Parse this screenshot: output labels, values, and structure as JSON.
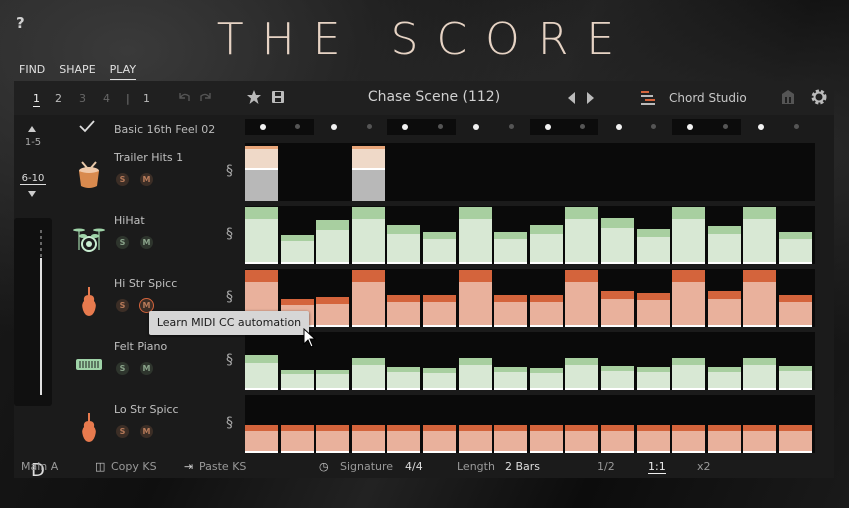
{
  "app": {
    "title": "THE SCORE",
    "help_label": "?"
  },
  "modes": [
    {
      "label": "FIND",
      "active": false
    },
    {
      "label": "SHAPE",
      "active": false
    },
    {
      "label": "PLAY",
      "active": true
    }
  ],
  "toolbar": {
    "pages": [
      "1",
      "2",
      "3",
      "4"
    ],
    "active_page": "1",
    "page_count": "1",
    "preset_name": "Chase Scene (112)",
    "chord_studio_label": "Chord Studio"
  },
  "left": {
    "range_top": "1-5",
    "range_bottom": "6-10",
    "key": "D"
  },
  "pattern": {
    "name": "Basic 16th Feel 02"
  },
  "tracks": [
    {
      "name": "Trailer Hits 1",
      "icon": "drum-icon"
    },
    {
      "name": "HiHat",
      "icon": "drumkit-icon"
    },
    {
      "name": "Hi Str Spicc",
      "icon": "violin-icon"
    },
    {
      "name": "Felt Piano",
      "icon": "piano-icon"
    },
    {
      "name": "Lo Str Spicc",
      "icon": "violin-icon"
    }
  ],
  "solo_label": "S",
  "mute_label": "M",
  "lanes": [
    {
      "color": "grey",
      "steps": [
        0.95,
        0,
        0,
        0.95,
        0,
        0,
        0,
        0,
        0,
        0,
        0,
        0,
        0,
        0,
        0,
        0
      ]
    },
    {
      "color": "green",
      "steps": [
        0.98,
        0.5,
        0.75,
        0.98,
        0.68,
        0.55,
        0.98,
        0.55,
        0.68,
        0.98,
        0.8,
        0.6,
        0.98,
        0.65,
        0.98,
        0.55
      ]
    },
    {
      "color": "orange",
      "steps": [
        0.98,
        0.48,
        0.52,
        0.98,
        0.55,
        0.55,
        0.98,
        0.55,
        0.55,
        0.98,
        0.62,
        0.58,
        0.98,
        0.62,
        0.98,
        0.55
      ]
    },
    {
      "color": "green",
      "steps": [
        0.6,
        0.35,
        0.35,
        0.55,
        0.4,
        0.38,
        0.55,
        0.4,
        0.38,
        0.55,
        0.42,
        0.4,
        0.55,
        0.4,
        0.55,
        0.42
      ]
    },
    {
      "color": "orange",
      "steps": [
        0.48,
        0.48,
        0.48,
        0.48,
        0.48,
        0.48,
        0.48,
        0.48,
        0.48,
        0.48,
        0.48,
        0.48,
        0.48,
        0.48,
        0.48,
        0.48
      ]
    }
  ],
  "accents": [
    1,
    0,
    1,
    0,
    1,
    0,
    1,
    0,
    1,
    0,
    1,
    0,
    1,
    0,
    1,
    0
  ],
  "bottom": {
    "main": "Main A",
    "copy_ks": "Copy KS",
    "paste_ks": "Paste KS",
    "signature_label": "Signature",
    "signature_value": "4/4",
    "length_label": "Length",
    "length_value": "2 Bars",
    "speed_half": "1/2",
    "speed_one": "1:1",
    "speed_double": "x2"
  },
  "tooltip": {
    "text": "Learn MIDI CC automation"
  },
  "colors": {
    "green_top": "#a8cfa0",
    "green_body": "#d8e8d4",
    "orange_top": "#d4643c",
    "orange_body": "#e9b19c",
    "grey_body": "#b8b8b8",
    "accent": "#e6d3c4"
  }
}
